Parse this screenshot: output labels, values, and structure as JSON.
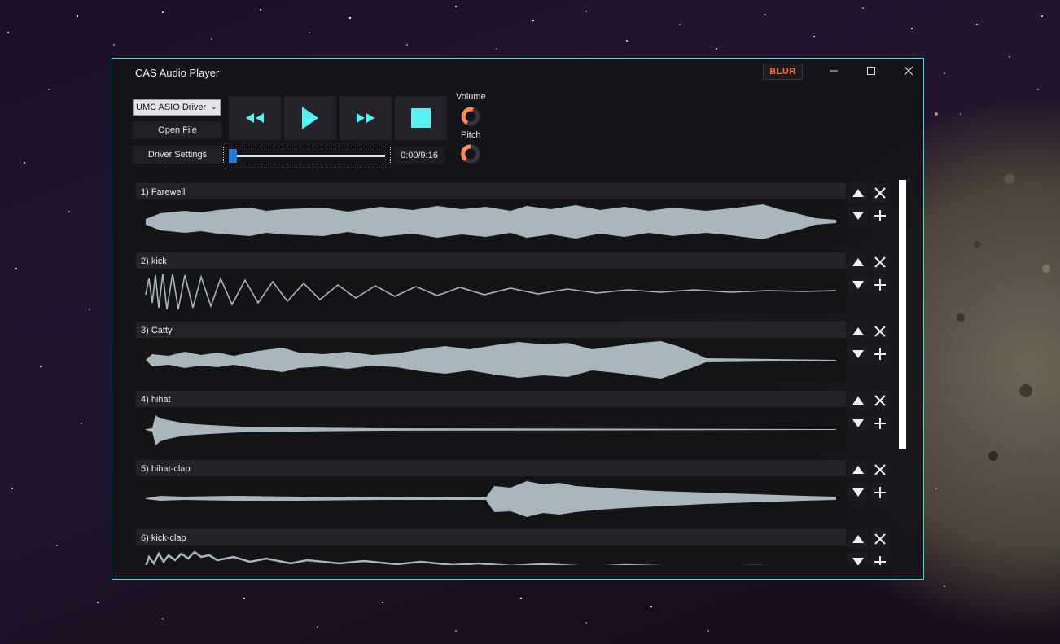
{
  "window": {
    "title": "CAS Audio Player",
    "blur_label": "BLUR",
    "minimize_icon": "minimize-icon",
    "maximize_icon": "maximize-icon",
    "close_icon": "close-icon"
  },
  "controls": {
    "driver_select": {
      "value": "UMC ASIO Driver"
    },
    "open_file_label": "Open File",
    "driver_settings_label": "Driver Settings",
    "rewind_icon": "rewind-icon",
    "play_icon": "play-icon",
    "fast_forward_icon": "fast-forward-icon",
    "stop_icon": "stop-icon",
    "volume_label": "Volume",
    "pitch_label": "Pitch",
    "seek_position": 0.0,
    "time_display": "0:00/9:16"
  },
  "colors": {
    "accent": "#4fd6df",
    "play_cyan": "#58f0f0",
    "knob_orange": "#ff8a55",
    "blur_orange": "#ff6a36",
    "waveform": "#a8b6bd"
  },
  "tracks": [
    {
      "name": "1) Farewell"
    },
    {
      "name": "2) kick"
    },
    {
      "name": "3) Catty"
    },
    {
      "name": "4) hihat"
    },
    {
      "name": "5) hihat-clap"
    },
    {
      "name": "6) kick-clap"
    }
  ]
}
